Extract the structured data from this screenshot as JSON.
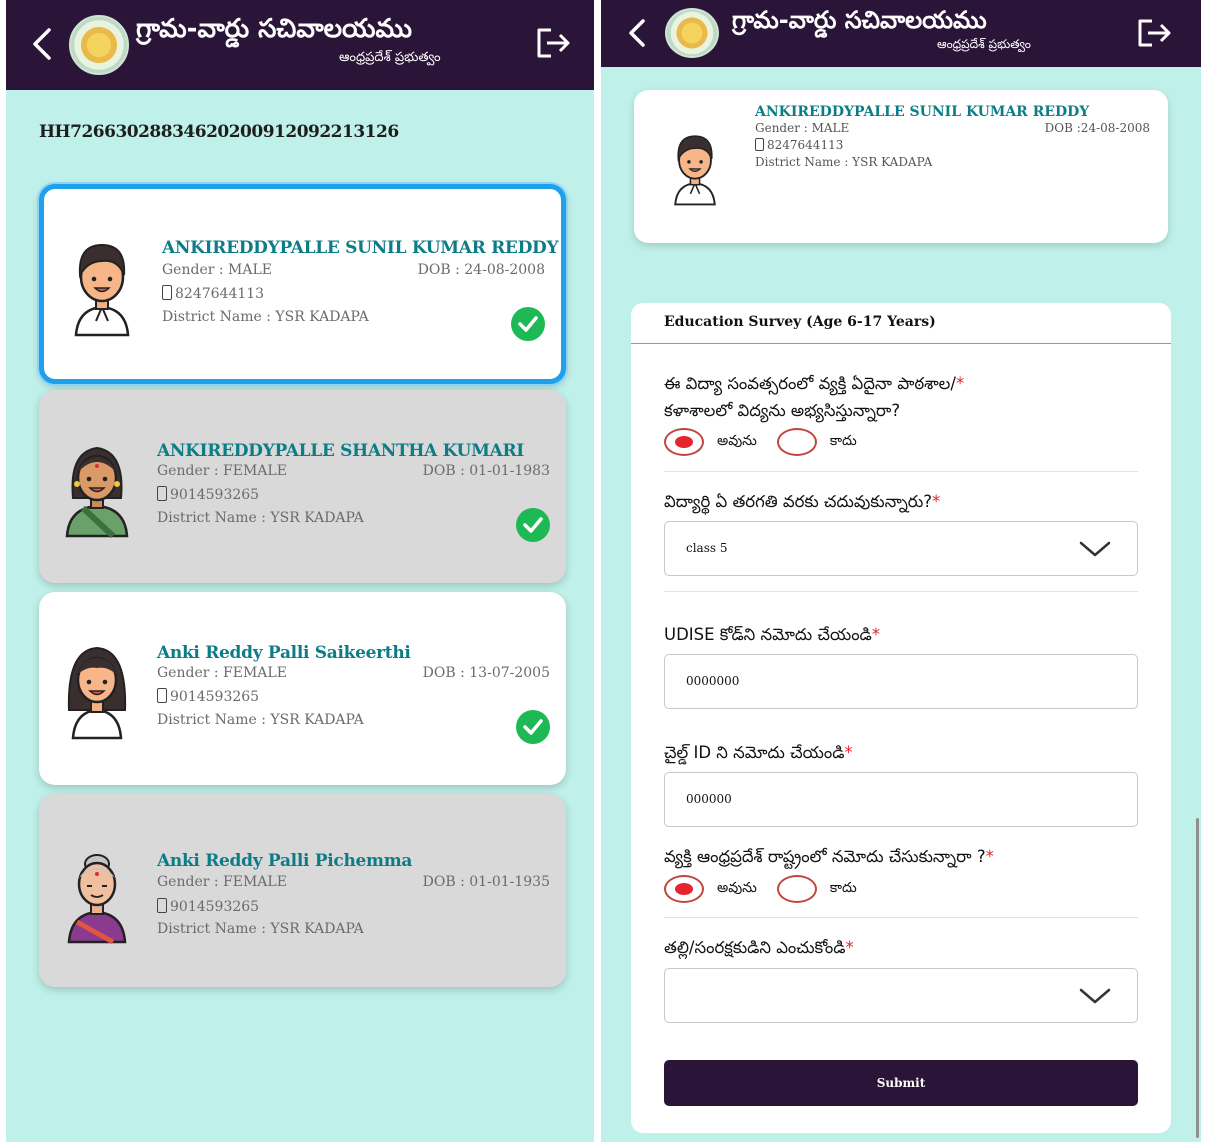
{
  "app": {
    "title": "గ్రామ-వార్డు సచివాలయము",
    "subtitle": "ఆంధ్రప్రదేశ్ ప్రభుత్వం"
  },
  "left": {
    "household_id": "HH72663028834620200912092213126",
    "members": [
      {
        "name": "ANKIREDDYPALLE SUNIL KUMAR REDDY",
        "gender": "Gender : MALE",
        "dob": "DOB : 24-08-2008",
        "phone": "8247644113",
        "district": "District Name : YSR KADAPA",
        "avatar": "boy-avatar-icon",
        "verified": true,
        "selected": true
      },
      {
        "name": "ANKIREDDYPALLE SHANTHA KUMARI",
        "gender": "Gender : FEMALE",
        "dob": "DOB : 01-01-1983",
        "phone": "9014593265",
        "district": "District Name : YSR KADAPA",
        "avatar": "woman-avatar-icon",
        "verified": true,
        "selected": false
      },
      {
        "name": "Anki Reddy Palli Saikeerthi",
        "gender": "Gender : FEMALE",
        "dob": "DOB : 13-07-2005",
        "phone": "9014593265",
        "district": "District Name : YSR KADAPA",
        "avatar": "girl-avatar-icon",
        "verified": true,
        "selected": false
      },
      {
        "name": "Anki Reddy Palli Pichemma",
        "gender": "Gender : FEMALE",
        "dob": "DOB : 01-01-1935",
        "phone": "9014593265",
        "district": "District Name : YSR KADAPA",
        "avatar": "elderly-woman-avatar-icon",
        "verified": false,
        "selected": false
      }
    ]
  },
  "right": {
    "profile": {
      "name": "ANKIREDDYPALLE SUNIL KUMAR REDDY",
      "gender": "Gender : MALE",
      "dob": "DOB :24-08-2008",
      "phone": "8247644113",
      "district": "District Name : YSR KADAPA"
    },
    "form": {
      "title": "Education Survey (Age 6-17 Years)",
      "q1_line1": "ఈ విద్యా సంవత్సరంలో వ్యక్తి ఏదైనా పాఠశాల/",
      "q1_line2": "కళాశాలలో విద్యను అభ్యసిస్తున్నారా?",
      "yes": "అవును",
      "no": "కాదు",
      "q2": "విద్యార్థి ఏ తరగతి వరకు చదువుకున్నారు?",
      "q2_value": "class 5",
      "q3": "UDISE కోడ్‌ని నమోదు చేయండి",
      "q3_value": "0000000",
      "q4": "చైల్డ్ ID ని నమోదు చేయండి",
      "q4_value": "000000",
      "q5": "వ్యక్తి ఆంధ్రప్రదేశ్ రాష్ట్రంలో నమోదు చేసుకున్నారా ?",
      "q6": "తల్లి/సంరక్షకుడిని ఎంచుకోండి",
      "q6_value": "",
      "required_mark": "*",
      "submit": "Submit"
    }
  },
  "colors": {
    "header": "#2a1437",
    "background": "#bff0e9",
    "name_teal": "#0c7d86",
    "selected_border": "#1ea0ea",
    "check_green": "#1db954",
    "radio_red": "#e5242e"
  }
}
